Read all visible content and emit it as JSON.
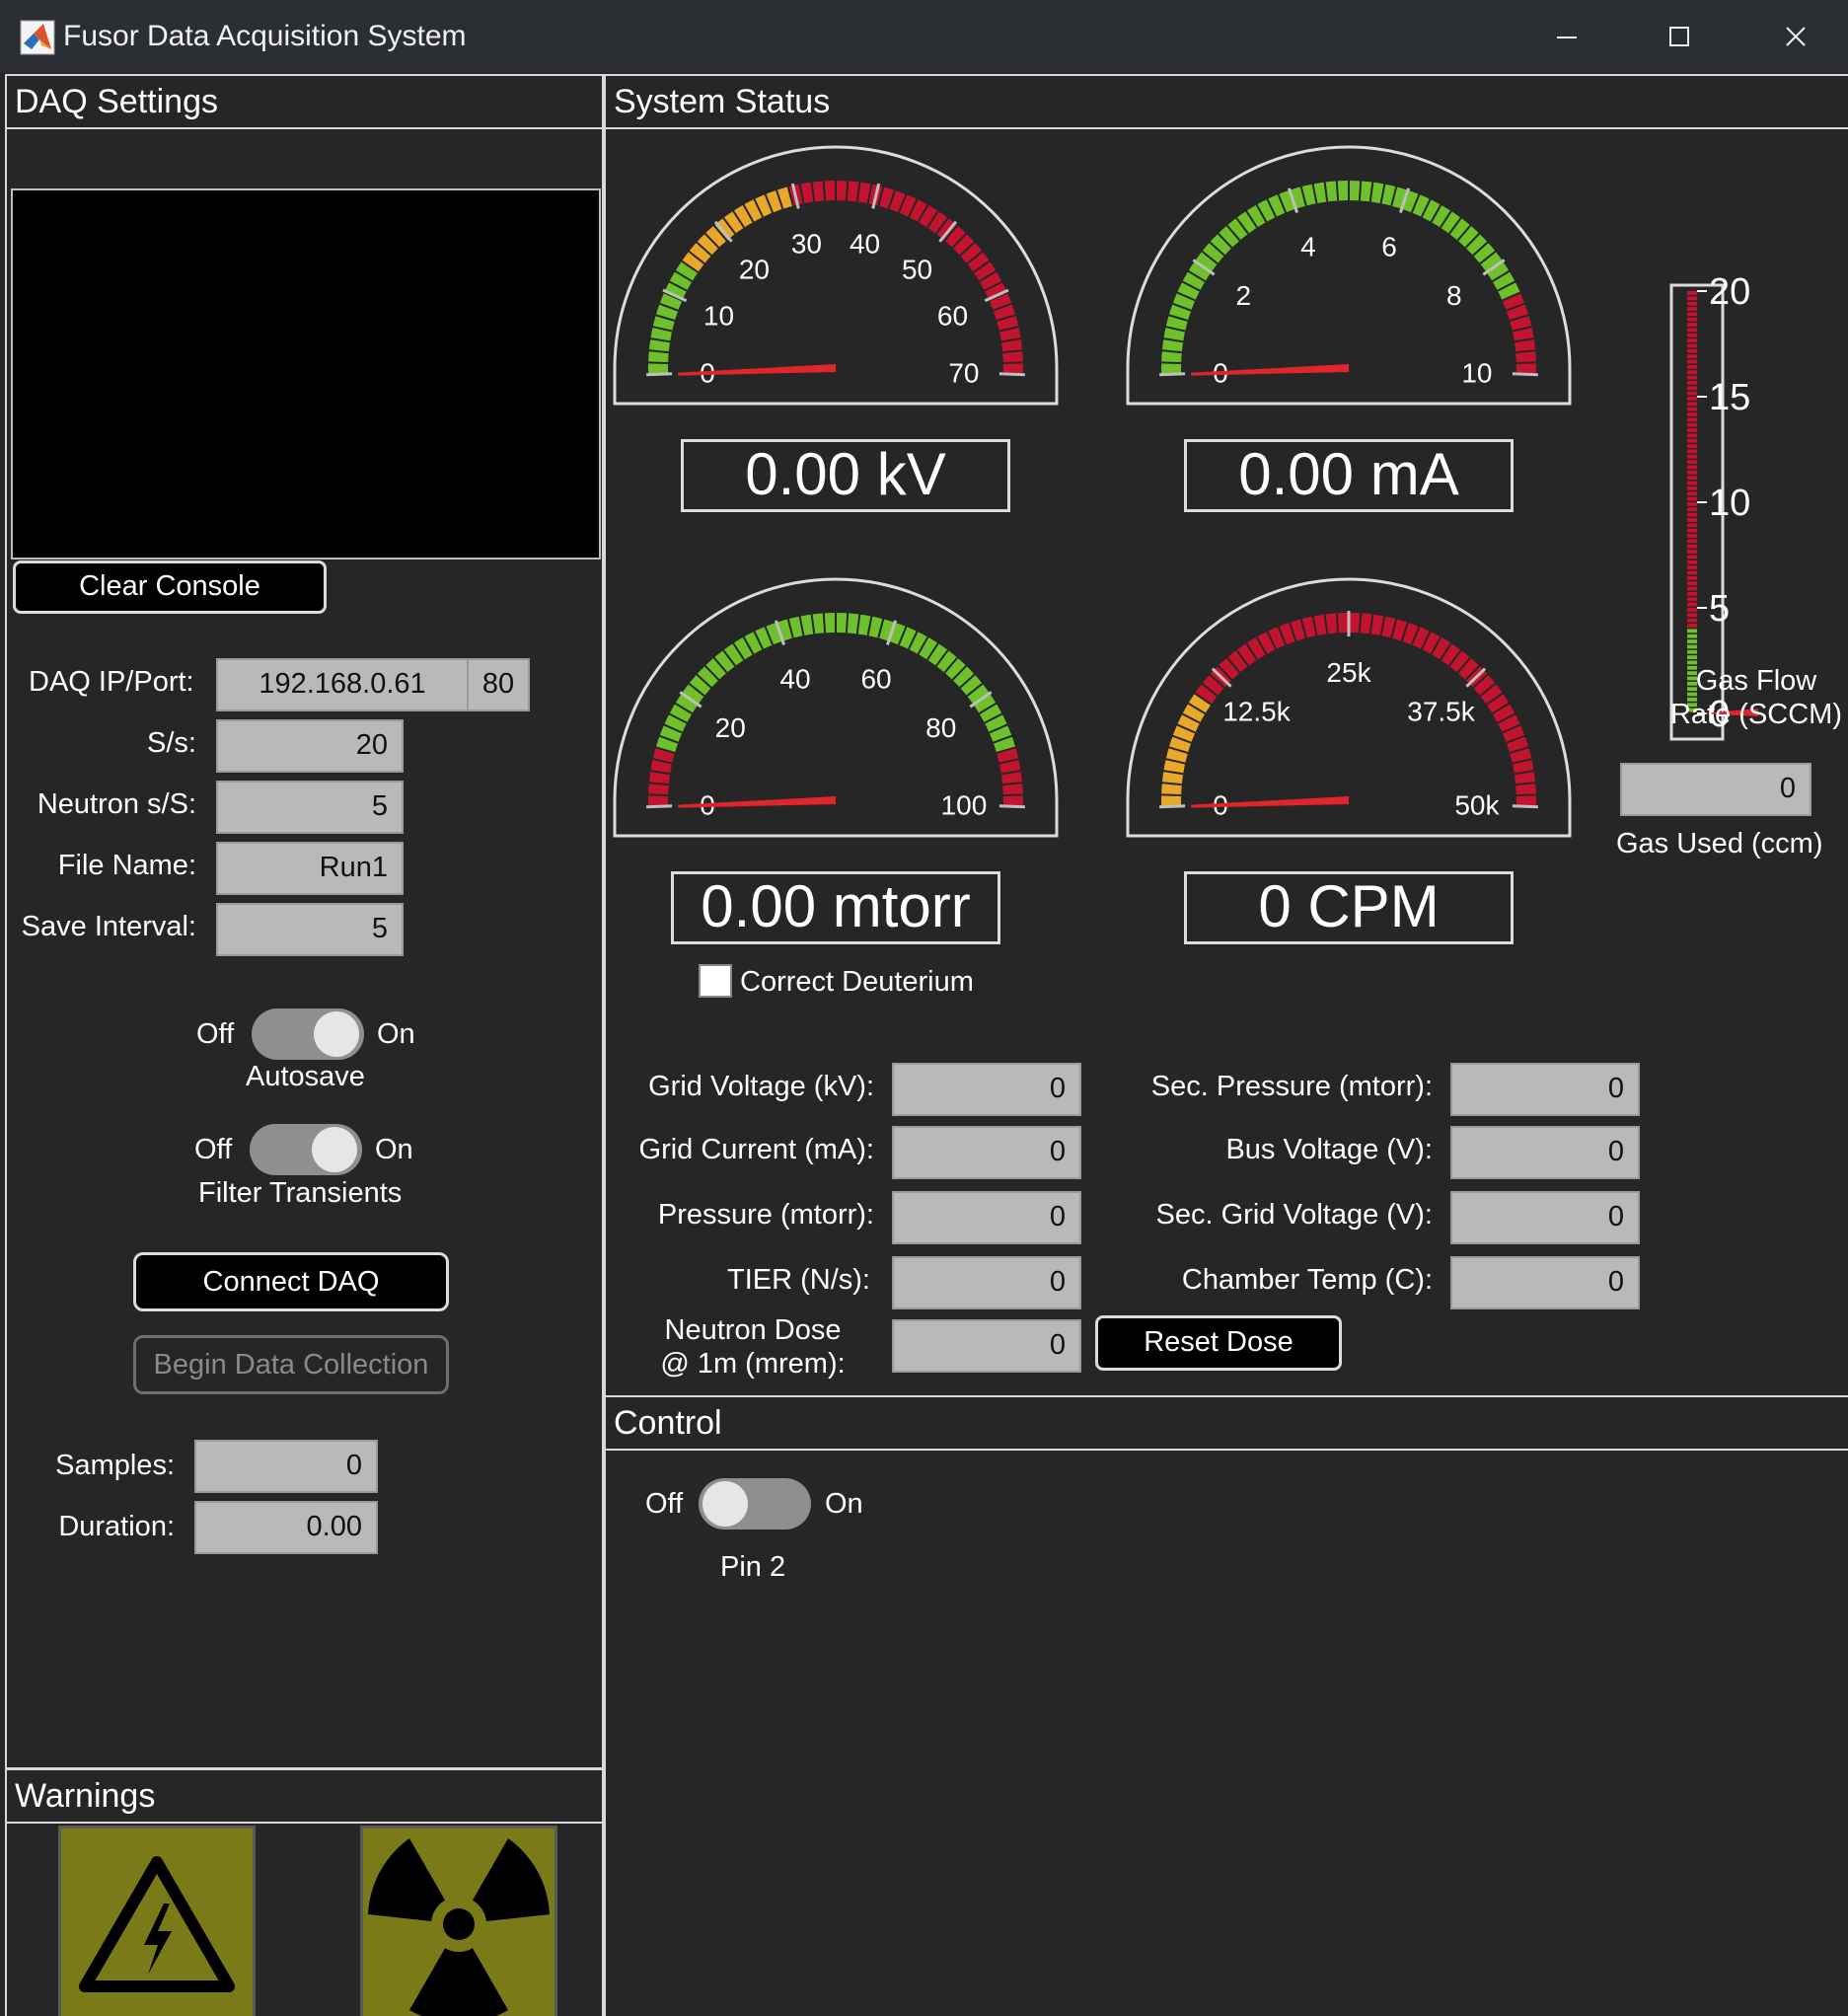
{
  "window": {
    "title": "Fusor Data Acquisition System",
    "minimize_icon": "minimize-icon",
    "maximize_icon": "maximize-icon",
    "close_icon": "close-icon"
  },
  "daq_settings": {
    "title": "DAQ Settings",
    "clear_console_label": "Clear Console",
    "ip_label": "DAQ IP/Port:",
    "ip_value": "192.168.0.61",
    "port_value": "80",
    "sps_label": "S/s:",
    "sps_value": "20",
    "neutron_label": "Neutron s/S:",
    "neutron_value": "5",
    "filename_label": "File Name:",
    "filename_value": "Run1",
    "save_interval_label": "Save Interval:",
    "save_interval_value": "5",
    "autosave": {
      "off": "Off",
      "on": "On",
      "label": "Autosave",
      "state": "on"
    },
    "filter": {
      "off": "Off",
      "on": "On",
      "label": "Filter Transients",
      "state": "on"
    },
    "connect_label": "Connect DAQ",
    "begin_label": "Begin Data Collection",
    "samples_label": "Samples:",
    "samples_value": "0",
    "duration_label": "Duration:",
    "duration_value": "0.00"
  },
  "warnings": {
    "title": "Warnings",
    "icons": [
      "high-voltage-warning-icon",
      "radiation-warning-icon"
    ],
    "color": "#7a7a19"
  },
  "system_status": {
    "title": "System Status",
    "gauges": [
      {
        "id": "kv",
        "ticks": [
          "0",
          "10",
          "20",
          "30",
          "40",
          "50",
          "60",
          "70"
        ],
        "value": 0,
        "readout": "0.00 kV",
        "bands": [
          {
            "from": 0,
            "to": 0.2,
            "color": "#6ec12a"
          },
          {
            "from": 0.2,
            "to": 0.42,
            "color": "#e9a82a"
          },
          {
            "from": 0.42,
            "to": 1,
            "color": "#c3132f"
          }
        ]
      },
      {
        "id": "ma",
        "ticks": [
          "0",
          "2",
          "4",
          "6",
          "8",
          "10"
        ],
        "value": 0,
        "readout": "0.00 mA",
        "bands": [
          {
            "from": 0,
            "to": 0.86,
            "color": "#6ec12a"
          },
          {
            "from": 0.86,
            "to": 1,
            "color": "#c3132f"
          }
        ]
      },
      {
        "id": "mtorr",
        "ticks": [
          "0",
          "20",
          "40",
          "60",
          "80",
          "100"
        ],
        "value": 0,
        "readout": "0.00 mtorr",
        "bands": [
          {
            "from": 0,
            "to": 0.1,
            "color": "#c3132f"
          },
          {
            "from": 0.1,
            "to": 0.9,
            "color": "#6ec12a"
          },
          {
            "from": 0.9,
            "to": 1,
            "color": "#c3132f"
          }
        ]
      },
      {
        "id": "cpm",
        "ticks": [
          "0",
          "12.5k",
          "25k",
          "37.5k",
          "50k"
        ],
        "value": 0,
        "readout": "0 CPM",
        "bands": [
          {
            "from": 0,
            "to": 0.2,
            "color": "#e9a82a"
          },
          {
            "from": 0.2,
            "to": 1,
            "color": "#c3132f"
          }
        ]
      }
    ],
    "needle_color": "#e0262b",
    "gas_flow": {
      "ticks": [
        "0",
        "5",
        "10",
        "15",
        "20"
      ],
      "value": 0,
      "label_line1": "Gas Flow",
      "label_line2": "Rate (SCCM)"
    },
    "gas_used": {
      "value": "0",
      "label": "Gas Used (ccm)"
    },
    "correct_deuterium_label": "Correct Deuterium",
    "correct_deuterium_checked": false,
    "readings_left": [
      {
        "label": "Grid Voltage (kV):",
        "value": "0"
      },
      {
        "label": "Grid Current (mA):",
        "value": "0"
      },
      {
        "label": "Pressure (mtorr):",
        "value": "0"
      },
      {
        "label": "TIER (N/s):",
        "value": "0"
      }
    ],
    "dose_label_line1": "Neutron Dose",
    "dose_label_line2": "@ 1m (mrem):",
    "dose_value": "0",
    "reset_dose_label": "Reset Dose",
    "readings_right": [
      {
        "label": "Sec. Pressure (mtorr):",
        "value": "0"
      },
      {
        "label": "Bus Voltage (V):",
        "value": "0"
      },
      {
        "label": "Sec. Grid Voltage (V):",
        "value": "0"
      },
      {
        "label": "Chamber Temp (C):",
        "value": "0"
      }
    ]
  },
  "control": {
    "title": "Control",
    "pin2": {
      "off": "Off",
      "on": "On",
      "label": "Pin 2",
      "state": "off"
    }
  }
}
